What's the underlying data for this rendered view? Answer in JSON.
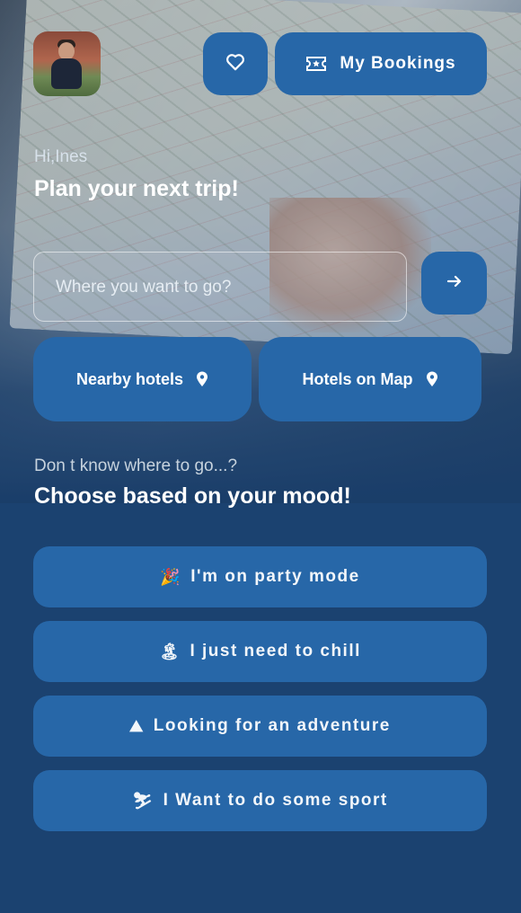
{
  "user": {
    "greeting": "Hi,Ines"
  },
  "header": {
    "bookings_label": "My Bookings",
    "favorites_icon": "heart-outline-icon",
    "bookings_icon": "ticket-icon"
  },
  "hero": {
    "title": "Plan your next trip!"
  },
  "search": {
    "placeholder": "Where you want to go?",
    "value": "",
    "submit_icon": "arrow-right-icon"
  },
  "quick_actions": [
    {
      "label": "Nearby hotels",
      "icon": "location-pin-icon"
    },
    {
      "label": "Hotels on Map",
      "icon": "location-pin-icon"
    }
  ],
  "mood_section": {
    "prompt": "Don t know where to go...?",
    "title": "Choose based on your mood!",
    "options": [
      {
        "emoji": "🎉",
        "label": "I'm on party mode"
      },
      {
        "emoji": "🏝",
        "label": "I just need to chill"
      },
      {
        "emoji": "⛰",
        "label": "Looking for an adventure"
      },
      {
        "emoji": "⛷",
        "label": "I Want to do some sport"
      }
    ]
  },
  "colors": {
    "background": "#1b4270",
    "button": "#2767a8",
    "text": "#ffffff"
  }
}
